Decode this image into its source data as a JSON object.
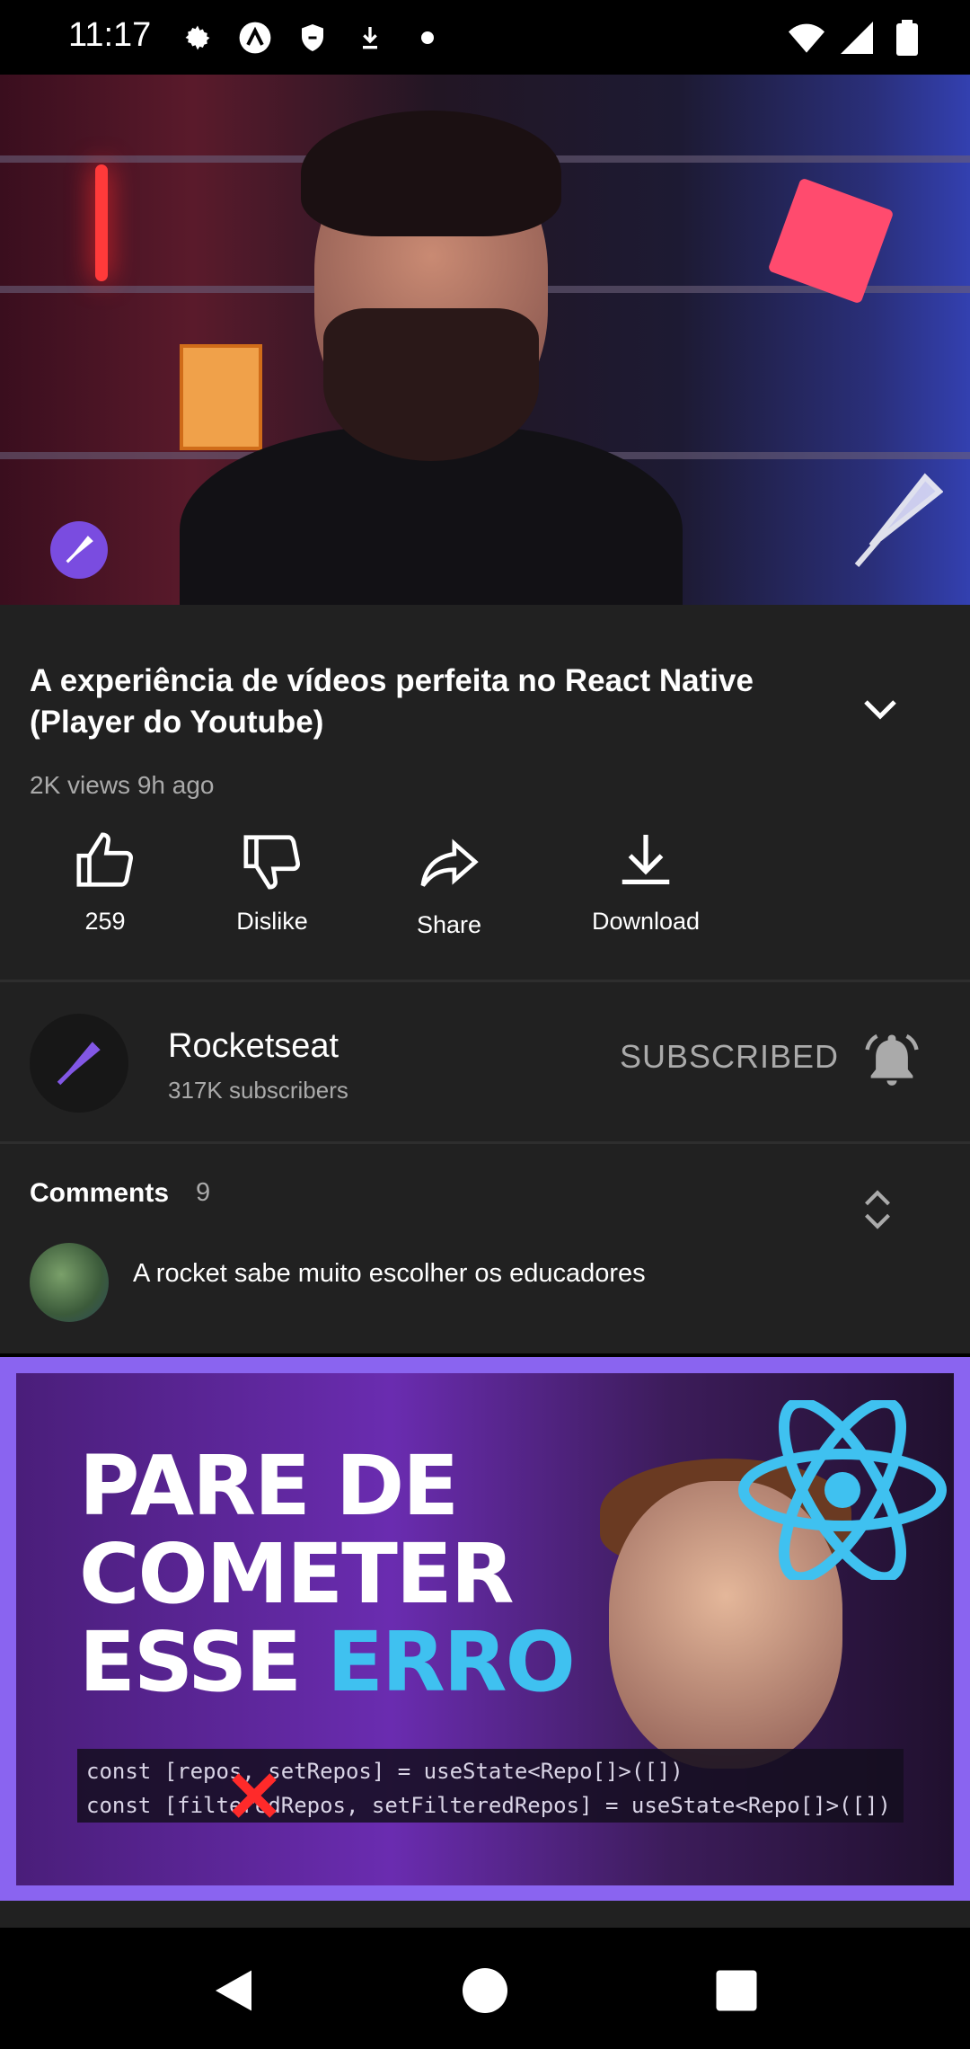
{
  "status_bar": {
    "time": "11:17",
    "icons_left": [
      "settings-icon",
      "app-a-icon",
      "shield-icon",
      "download-arrow-icon",
      "dot-icon"
    ],
    "icons_right": [
      "wifi-icon",
      "signal-icon",
      "battery-icon"
    ]
  },
  "video": {
    "title": "A experiência de vídeos perfeita no React Native (Player do Youtube)",
    "meta": "2K views 9h ago"
  },
  "actions": {
    "like_label": "259",
    "dislike_label": "Dislike",
    "share_label": "Share",
    "download_label": "Download"
  },
  "channel": {
    "name": "Rocketseat",
    "subscribers": "317K subscribers",
    "subscribe_button": "SUBSCRIBED"
  },
  "comments": {
    "title": "Comments",
    "count": "9",
    "first_comment": "A rocket sabe muito escolher os educadores"
  },
  "next_video": {
    "thumb_line1": "PARE DE",
    "thumb_line2": "COMETER",
    "thumb_line3_plain": "ESSE ",
    "thumb_line3_accent": "ERRO",
    "code_line1": "const [repos, setRepos] = useState<Repo[]>([])",
    "code_line2": "const [filteredRepos, setFilteredRepos] = useState<Repo[]>([])"
  },
  "colors": {
    "background": "#212121",
    "secondary_text": "#aaaaaa",
    "brand_purple": "#7a4ce0",
    "thumb_border": "#8a64f0",
    "accent_blue": "#3fc1f0"
  }
}
